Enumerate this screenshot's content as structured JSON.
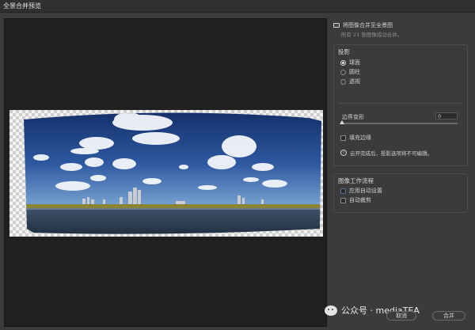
{
  "window": {
    "title": "全景合并预览"
  },
  "panel": {
    "merge_to_panorama": {
      "label": "将图像合并至全景图",
      "checked": true
    },
    "sub_note": "所有 21 张图像成功合并。",
    "projection": {
      "title": "投影",
      "options": [
        {
          "label": "球面",
          "selected": true
        },
        {
          "label": "圆柱",
          "selected": false
        },
        {
          "label": "透视",
          "selected": false
        }
      ]
    },
    "boundary_warp": {
      "label": "边界变形",
      "value": "0",
      "fraction": 0.0
    },
    "fill_edges": {
      "label": "填充边缘",
      "checked": false
    },
    "info_text": "云开完成后，投影选项将不可编辑。",
    "workflow": {
      "title": "图像工作流程",
      "options": [
        {
          "label": "应用自动设置",
          "checked": false
        },
        {
          "label": "自动裁剪",
          "checked": false
        }
      ]
    }
  },
  "buttons": {
    "cancel": "取消",
    "create": "合并"
  },
  "watermark": "公众号 · mediaTEA",
  "colors": {
    "sky_top": "#16336e",
    "sky_bottom": "#5c8cc8",
    "water": "#2c3f55",
    "grass": "#8d8a3a"
  }
}
